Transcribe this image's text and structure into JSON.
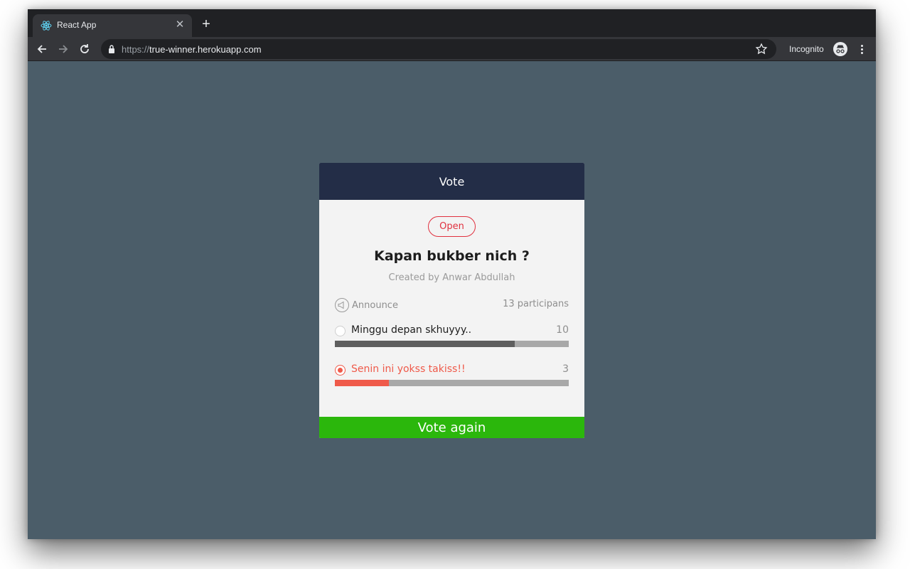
{
  "browser": {
    "tab_title": "React App",
    "tab_icon": "react-logo-icon",
    "url_scheme": "https://",
    "url_host": "true-winner.herokuapp.com",
    "incognito_label": "Incognito"
  },
  "card": {
    "header_title": "Vote",
    "status": "Open",
    "question": "Kapan bukber nich ?",
    "creator": "Created by Anwar Abdullah",
    "announce_label": "Announce",
    "participants": "13 participans",
    "button_label": "Vote again",
    "options": [
      {
        "label": "Minggu depan skhuyyy..",
        "count": "10",
        "votes": 10,
        "share": 0.77,
        "selected": false,
        "bar_color": "#5e5e5e"
      },
      {
        "label": "Senin ini yokss takiss!!",
        "count": "3",
        "votes": 3,
        "share": 0.23,
        "selected": true,
        "bar_color": "#ef5a4a"
      }
    ]
  },
  "colors": {
    "page_background": "#4b5d69",
    "header_background": "#232d47",
    "accent_red": "#ef5a4a",
    "button_green": "#2bb70c"
  }
}
